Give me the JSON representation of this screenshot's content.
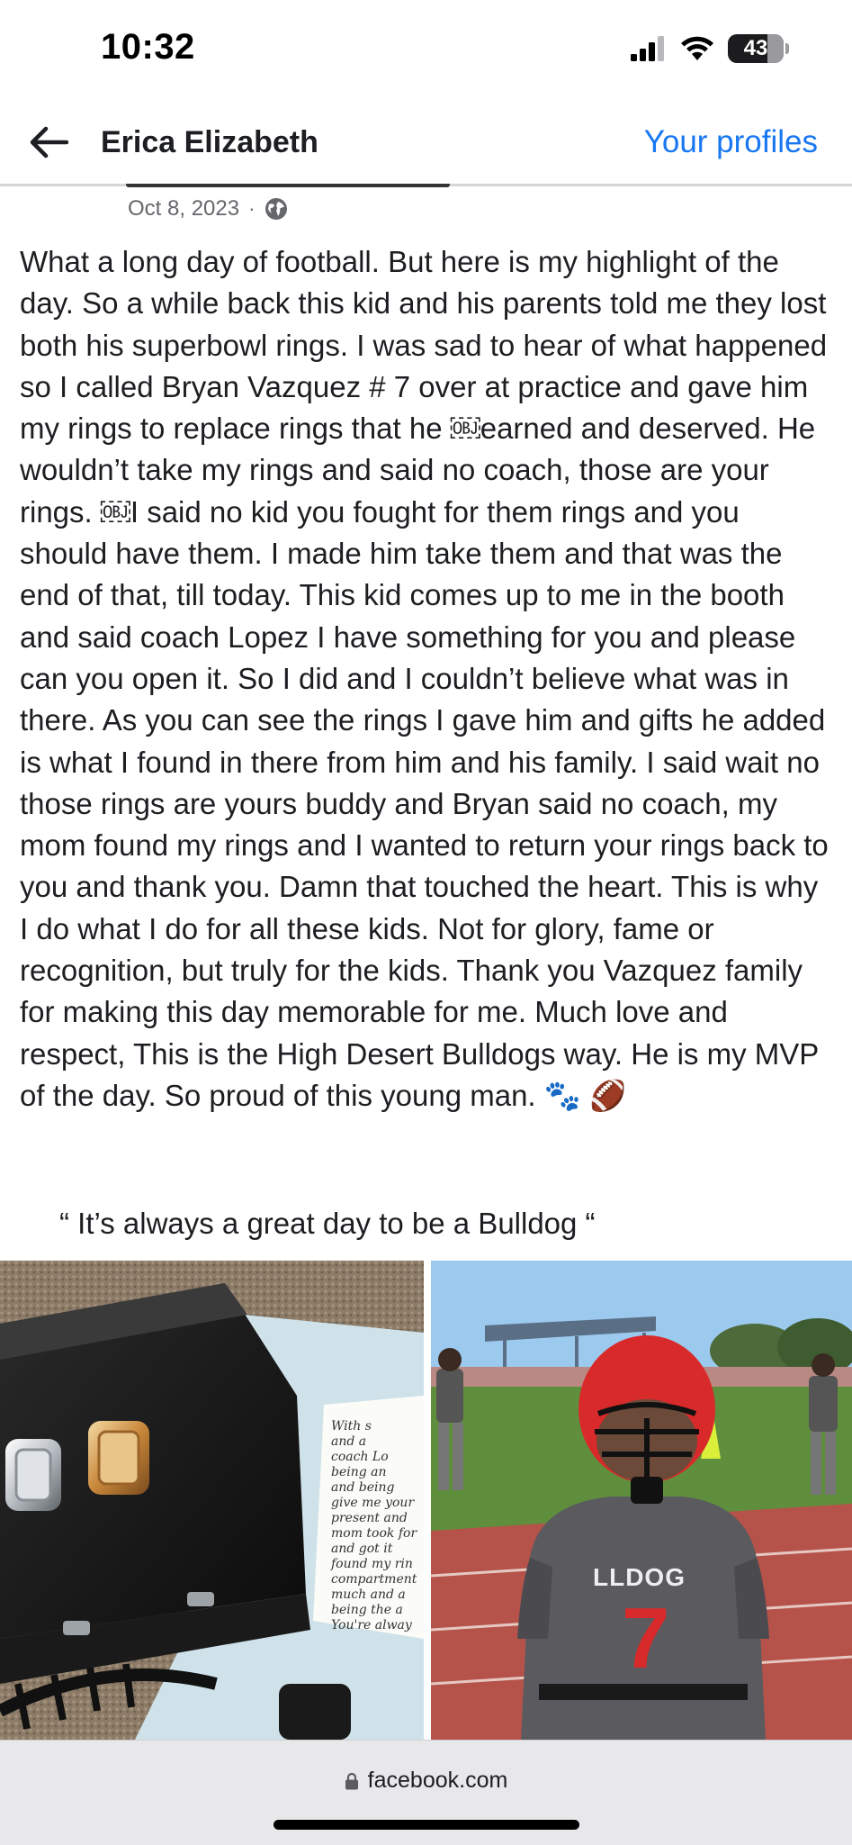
{
  "status_bar": {
    "time": "10:32",
    "battery_level": "43",
    "icons": [
      "cellular-signal-icon",
      "wifi-icon",
      "battery-icon"
    ]
  },
  "header": {
    "back_icon": "arrow-left-icon",
    "title": "Erica Elizabeth",
    "profiles_link": "Your profiles"
  },
  "post": {
    "date": "Oct 8, 2023",
    "separator": "·",
    "privacy_icon": "globe-icon",
    "body": "What a long day of football. But here is my highlight of the day. So a while back this kid and his parents told me they lost both his superbowl rings. I was sad to hear of what happened so I called Bryan Vazquez # 7 over at practice and gave him my rings to replace rings that he ￼earned and deserved. He wouldn’t take my rings and said no coach, those are your rings. ￼I said no kid you fought for them rings and you should have them. I made him take them and that was the end of that, till today. This kid comes up to me in the booth and said coach Lopez I have something for you and please can you open it. So I did and I couldn’t believe what was in there. As you can see the rings I gave him and gifts he added is what I found in there from him and his family. I said wait no those rings are yours buddy and Bryan said no coach, my mom found my rings and I wanted to return your rings back to you and thank you. Damn that touched the heart. This is why I do what I do for all these kids. Not for glory, fame or recognition, but truly for the kids. Thank you Vazquez family for making this day memorable for me. Much love and respect, This is the High Desert Bulldogs way. He is my MVP of the day. So proud of this young man. 🐾 🏈",
    "quote": "“ It’s always a great day to be a Bulldog “",
    "photos": [
      {
        "label": "rings-box-photo",
        "note_lines": [
          "With s",
          "and a",
          "coach Lo",
          "being an",
          "and being",
          "give me your",
          "present and",
          "mom took for",
          "and got it",
          "found my rin",
          "compartment",
          "much and a",
          "being the a",
          "You're alway"
        ]
      },
      {
        "label": "football-player-photo",
        "jersey_text": "LLDOG",
        "jersey_number": "7"
      }
    ]
  },
  "browser_bar": {
    "lock_icon": "lock-icon",
    "url": "facebook.com"
  }
}
